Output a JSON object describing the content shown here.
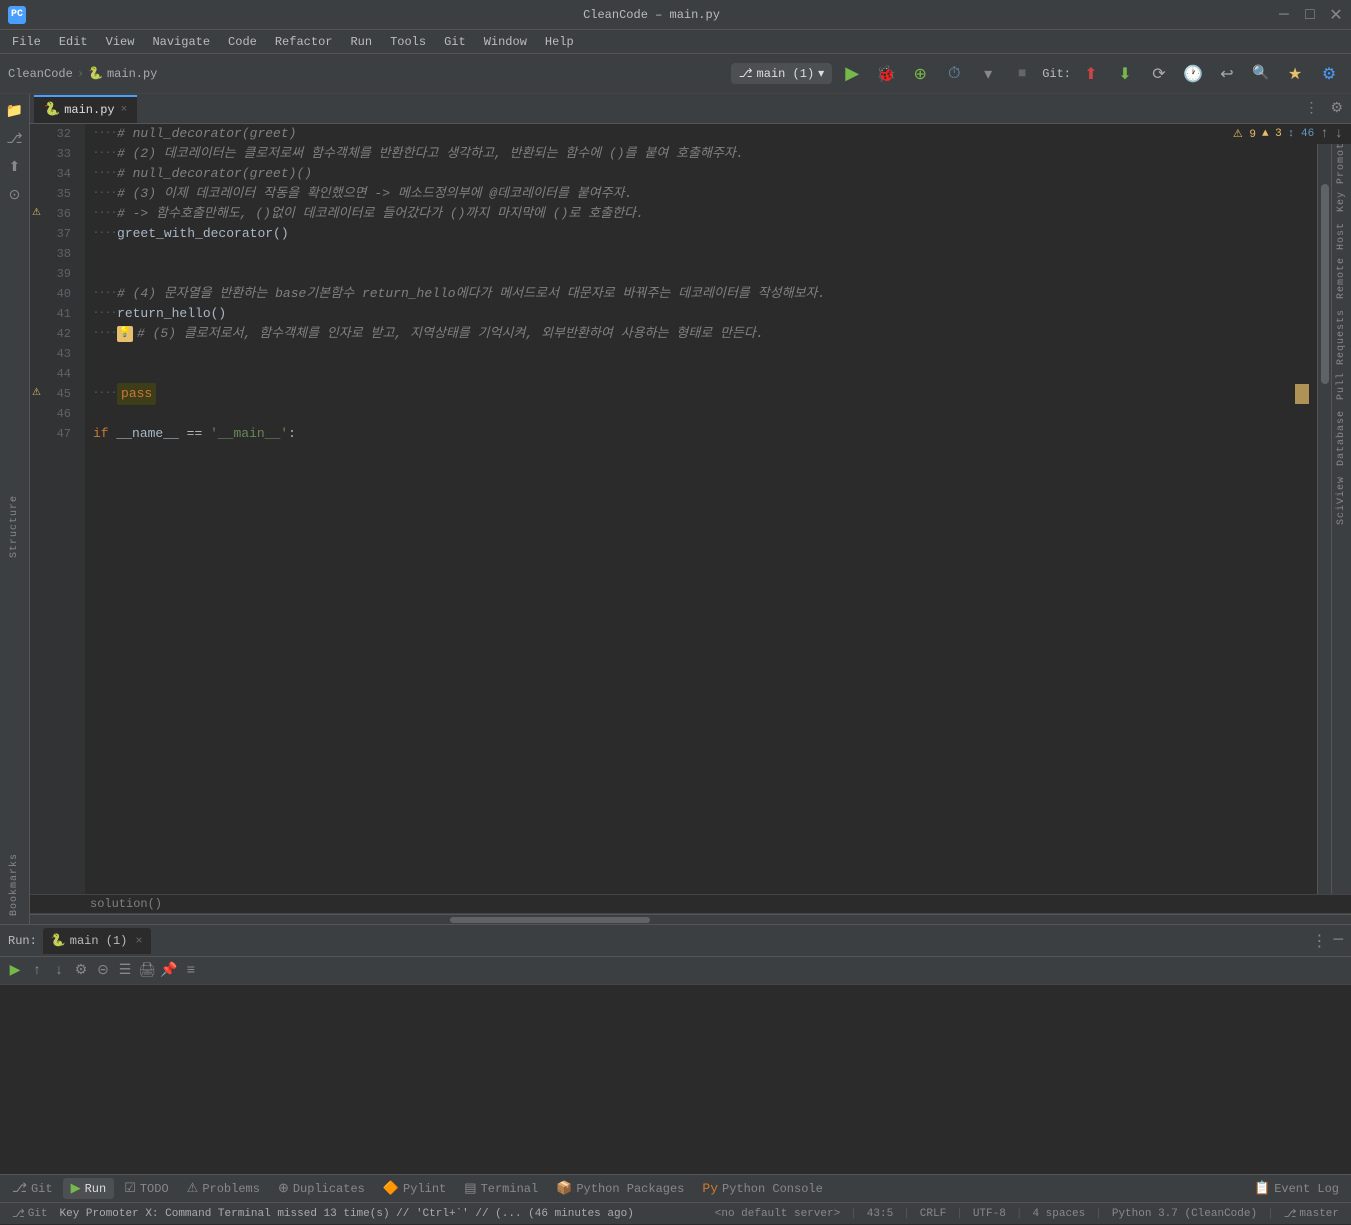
{
  "app": {
    "title": "CleanCode – main.py",
    "icon": "PC"
  },
  "titlebar": {
    "title": "CleanCode – main.py",
    "minimize": "─",
    "maximize": "□",
    "close": "✕"
  },
  "menubar": {
    "items": [
      "File",
      "Edit",
      "View",
      "Navigate",
      "Code",
      "Refactor",
      "Run",
      "Tools",
      "Git",
      "Window",
      "Help"
    ]
  },
  "toolbar": {
    "project": "CleanCode",
    "separator": "›",
    "file": "main.py",
    "branch_icon": "⎇",
    "branch": "main (1)",
    "run_btn": "▶",
    "git_label": "Git:",
    "search_icon": "🔍",
    "star_icon": "⭐"
  },
  "editor": {
    "tab_icon": "🐍",
    "tab_name": "main.py",
    "tab_close": "×",
    "error_bar": {
      "warnings": "⚠9",
      "errors": "▲3",
      "info": "↕46",
      "up": "↑",
      "down": "↓"
    },
    "lines": [
      {
        "num": 32,
        "indent": "····",
        "content": "# null_decorator(greet)",
        "type": "comment"
      },
      {
        "num": 33,
        "indent": "····",
        "content": "# (2) 데코레이터는 클로저로써 함수객체를 반환한다고 생각하고, 반환되는 함수에 ()를 붙여 호출해주자.",
        "type": "comment"
      },
      {
        "num": 34,
        "indent": "····",
        "content": "# null_decorator(greet)()",
        "type": "comment"
      },
      {
        "num": 35,
        "indent": "····",
        "content": "# (3) 이제 데코레이터 작동을 확인했으면 -> 메소드정의부에 @데코레이터를 붙여주자.",
        "type": "comment"
      },
      {
        "num": 36,
        "indent": "····",
        "content": "# -> 함수호출만해도, ()없이 데코레이터로 들어갔다가 ()까지 마지막에 ()로 호출한다.",
        "type": "comment",
        "has_indicator": true
      },
      {
        "num": 37,
        "indent": "····",
        "content": "greet_with_decorator()",
        "type": "code"
      },
      {
        "num": 38,
        "indent": "",
        "content": "",
        "type": "empty"
      },
      {
        "num": 39,
        "indent": "",
        "content": "",
        "type": "empty"
      },
      {
        "num": 40,
        "indent": "····",
        "content": "# (4) 문자열을 반환하는 base기본함수 return_hello에다가 메서드로서 대문자로 바꿔주는 데코레이터를 작성해보자.",
        "type": "comment"
      },
      {
        "num": 41,
        "indent": "····",
        "content": "return_hello()",
        "type": "code"
      },
      {
        "num": 42,
        "indent": "····",
        "content": "# (5) 클로저로서, 함수객체를 인자로 받고, 지역상태를 기억시켜, 외부반환하여 사용하는 형태로 만든다.",
        "type": "comment",
        "has_warning": true
      },
      {
        "num": 43,
        "indent": "",
        "content": "",
        "type": "empty"
      },
      {
        "num": 44,
        "indent": "",
        "content": "",
        "type": "empty"
      },
      {
        "num": 45,
        "indent": "····",
        "content": "pass",
        "type": "pass",
        "has_indicator": true
      },
      {
        "num": 46,
        "indent": "",
        "content": "",
        "type": "empty"
      },
      {
        "num": 47,
        "indent": "",
        "content": "if __name__ == '__main__':",
        "type": "code",
        "fold": true
      }
    ]
  },
  "breadcrumb": {
    "text": "solution()"
  },
  "run_panel": {
    "label": "Run:",
    "tab_icon": "🐍",
    "tab_name": "main (1)",
    "tab_close": "×"
  },
  "bottom_tabs": [
    {
      "icon": "🔀",
      "label": "Git"
    },
    {
      "icon": "▶",
      "label": "Run",
      "active": true
    },
    {
      "icon": "☑",
      "label": "TODO"
    },
    {
      "icon": "⚠",
      "label": "Problems"
    },
    {
      "icon": "⊕",
      "label": "Duplicates"
    },
    {
      "icon": "🔶",
      "label": "Pylint"
    },
    {
      "icon": "▤",
      "label": "Terminal"
    },
    {
      "icon": "📦",
      "label": "Python Packages"
    },
    {
      "icon": "Pu",
      "label": "Python Console"
    },
    {
      "icon": "📋",
      "label": "Event Log"
    }
  ],
  "status_bar": {
    "git_icon": "⎇",
    "git_label": "Git",
    "message": "Key Promoter X: Command Terminal missed 13 time(s) // 'Ctrl+`' // (... (46 minutes ago)",
    "server": "<no default server>",
    "position": "43:5",
    "encoding": "CRLF",
    "charset": "UTF-8",
    "indent": "4 spaces",
    "python": "Python 3.7 (CleanCode)",
    "branch": "master"
  },
  "right_sidebar_labels": [
    "Key Promoter",
    "Remote Host",
    "Pull Requests",
    "Database",
    "SciView"
  ],
  "run_panel_buttons": {
    "play": "▶",
    "up": "↑",
    "down": "↓",
    "settings": "⚙",
    "stop_filter": "⊝",
    "filter": "☰",
    "print": "🖨",
    "pin": "📌",
    "wrap": "≡",
    "more": "⋮",
    "minimize": "─"
  }
}
